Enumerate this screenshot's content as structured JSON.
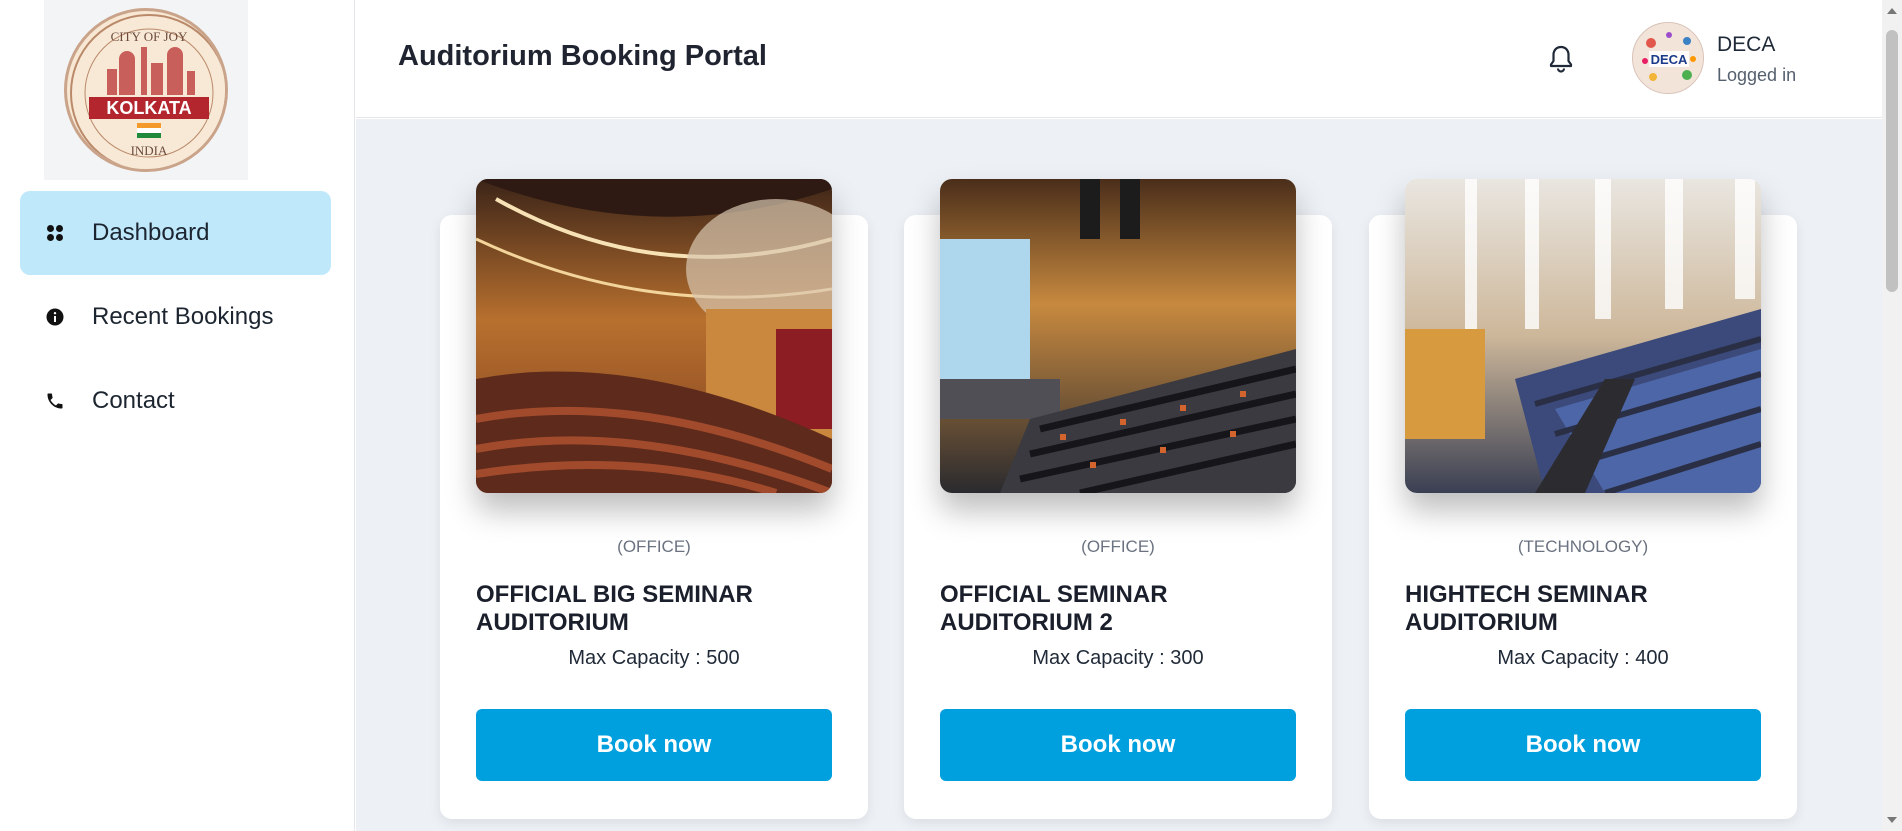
{
  "logo": {
    "top_text": "CITY OF JOY",
    "name": "KOLKATA",
    "bottom_text": "INDIA"
  },
  "sidebar": {
    "items": [
      {
        "label": "Dashboard",
        "icon": "grid-icon",
        "active": true
      },
      {
        "label": "Recent Bookings",
        "icon": "info-icon",
        "active": false
      },
      {
        "label": "Contact",
        "icon": "phone-icon",
        "active": false
      }
    ]
  },
  "header": {
    "title": "Auditorium Booking Portal",
    "notification_icon": "bell-icon",
    "user": {
      "avatar_text": "DECA",
      "name": "DECA",
      "status": "Logged in"
    }
  },
  "cards": [
    {
      "category": "(OFFICE)",
      "title": "OFFICIAL BIG SEMINAR AUDITORIUM",
      "capacity": "Max Capacity : 500",
      "button": "Book now"
    },
    {
      "category": "(OFFICE)",
      "title": "OFFICIAL SEMINAR AUDITORIUM 2",
      "capacity": "Max Capacity : 300",
      "button": "Book now"
    },
    {
      "category": "(TECHNOLOGY)",
      "title": "HIGHTECH SEMINAR AUDITORIUM",
      "capacity": "Max Capacity : 400",
      "button": "Book now"
    }
  ],
  "colors": {
    "accent": "#009fde",
    "active_nav": "#bfe8fb",
    "main_bg": "#edf1f6"
  }
}
